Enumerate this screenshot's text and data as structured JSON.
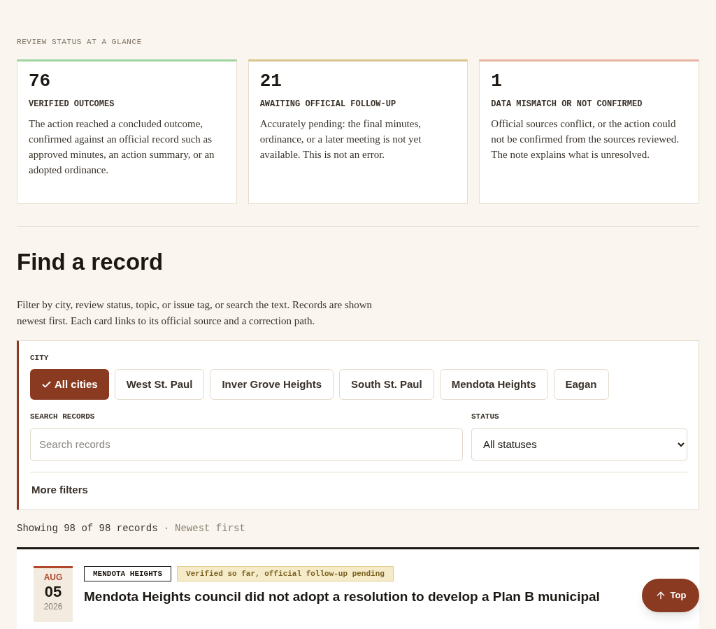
{
  "overview": {
    "heading": "REVIEW STATUS AT A GLANCE",
    "cards": [
      {
        "count": "76",
        "title": "VERIFIED OUTCOMES",
        "description": "The action reached a concluded outcome, confirmed against an official record such as approved minutes, an action summary, or an adopted ordinance.",
        "color": "#9fd3a0"
      },
      {
        "count": "21",
        "title": "AWAITING OFFICIAL FOLLOW-UP",
        "description": "Accurately pending: the final minutes, ordinance, or a later meeting is not yet available. This is not an error.",
        "color": "#d9c48a"
      },
      {
        "count": "1",
        "title": "DATA MISMATCH OR NOT CONFIRMED",
        "description": "Official sources conflict, or the action could not be confirmed from the sources reviewed. The note explains what is unresolved.",
        "color": "#e8b4a0"
      }
    ]
  },
  "finder": {
    "title": "Find a record",
    "intro": "Filter by city, review status, topic, or issue tag, or search the text. Records are shown newest first. Each card links to its official source and a correction path.",
    "city_label": "CITY",
    "cities": [
      {
        "label": "All cities",
        "selected": true
      },
      {
        "label": "West St. Paul",
        "selected": false
      },
      {
        "label": "Inver Grove Heights",
        "selected": false
      },
      {
        "label": "South St. Paul",
        "selected": false
      },
      {
        "label": "Mendota Heights",
        "selected": false
      },
      {
        "label": "Eagan",
        "selected": false
      }
    ],
    "search_label": "SEARCH RECORDS",
    "search": {
      "placeholder": "Search records"
    },
    "status_label": "STATUS",
    "status": {
      "value": "All statuses"
    },
    "more_filters": "More filters"
  },
  "results": {
    "count": "Showing 98 of 98 records",
    "separator": "·",
    "sort": "Newest first"
  },
  "records": [
    {
      "month": "AUG",
      "day": "05",
      "year": "2026",
      "city": "MENDOTA HEIGHTS",
      "status": "Verified so far, official follow-up pending",
      "title": "Mendota Heights council did not adopt a resolution to develop a Plan B municipal"
    }
  ],
  "top_button": {
    "label": "Top"
  }
}
